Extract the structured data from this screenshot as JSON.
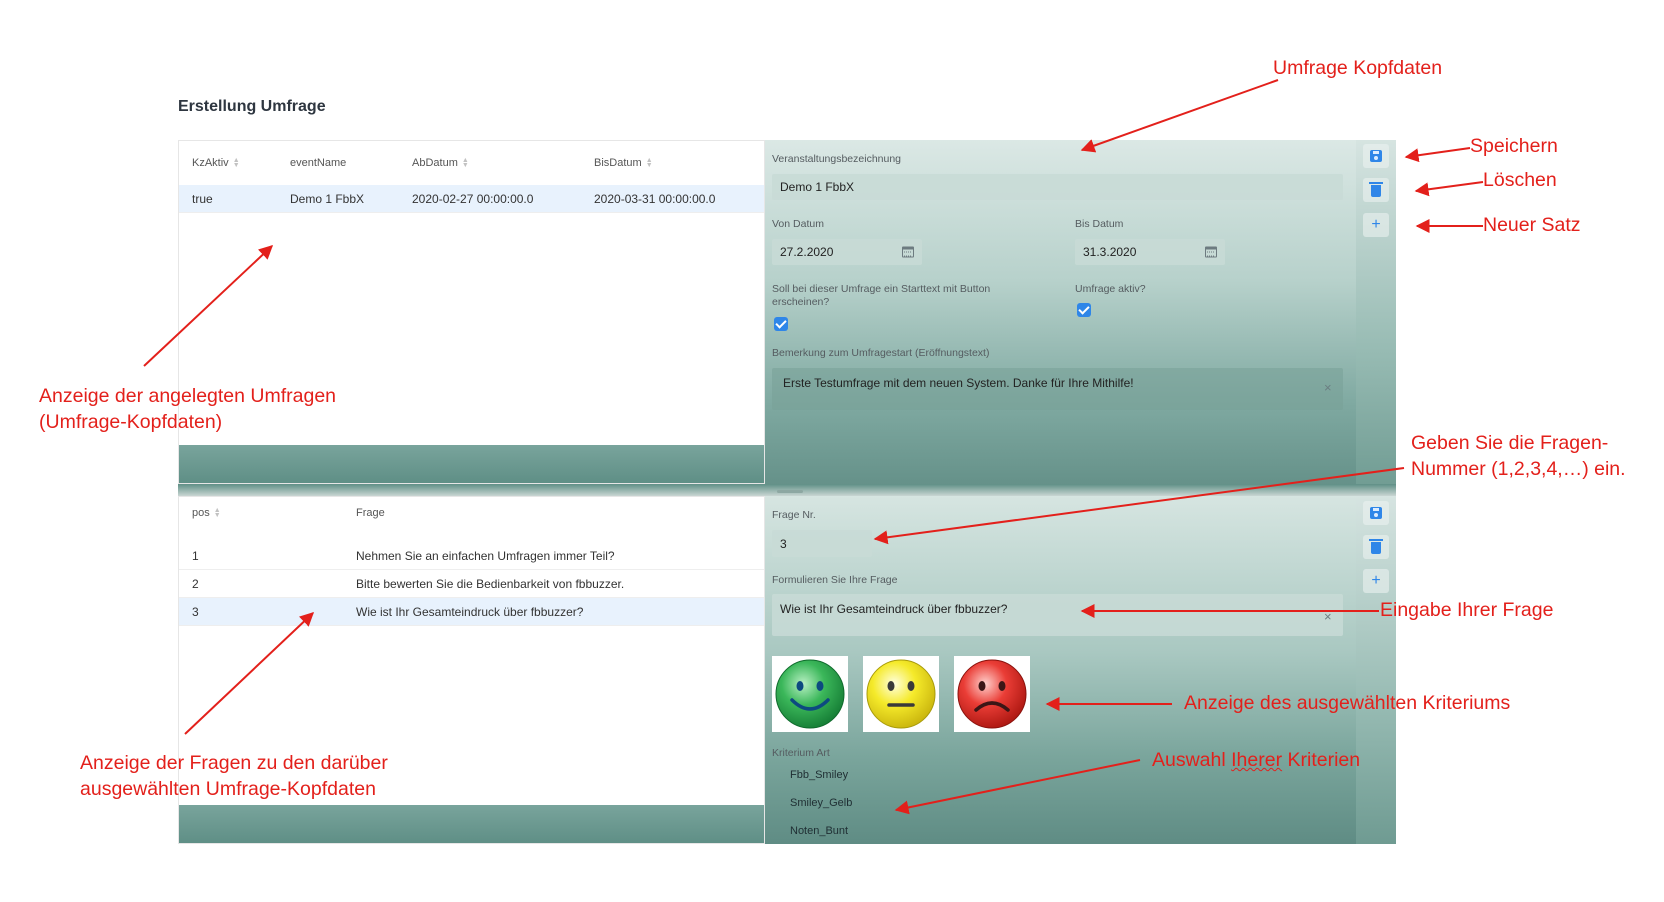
{
  "page": {
    "title": "Erstellung Umfrage"
  },
  "survey_table": {
    "columns": [
      "KzAktiv",
      "eventName",
      "AbDatum",
      "BisDatum"
    ],
    "rows": [
      [
        "true",
        "Demo 1 FbbX",
        "2020-02-27 00:00:00.0",
        "2020-03-31 00:00:00.0"
      ]
    ],
    "selected_row": 0
  },
  "survey_form": {
    "name_label": "Veranstaltungsbezeichnung",
    "name_value": "Demo 1 FbbX",
    "from_label": "Von Datum",
    "from_value": "27.2.2020",
    "to_label": "Bis Datum",
    "to_value": "31.3.2020",
    "starttext_label_1": "Soll bei dieser Umfrage ein Starttext mit Button",
    "starttext_label_2": "erscheinen?",
    "starttext_checked": true,
    "active_label": "Umfrage aktiv?",
    "active_checked": true,
    "remark_label": "Bemerkung zum Umfragestart (Eröffnungstext)",
    "remark_value": "Erste Testumfrage mit dem neuen System. Danke für Ihre Mithilfe!",
    "clear_glyph": "×"
  },
  "question_table": {
    "columns": [
      "pos",
      "Frage"
    ],
    "rows": [
      [
        "1",
        "Nehmen Sie an einfachen Umfragen immer Teil?"
      ],
      [
        "2",
        "Bitte bewerten Sie die Bedienbarkeit von fbbuzzer."
      ],
      [
        "3",
        "Wie ist Ihr Gesamteindruck über fbbuzzer?"
      ]
    ],
    "selected_row": 2
  },
  "question_form": {
    "nr_label": "Frage Nr.",
    "nr_value": "3",
    "question_label": "Formulieren Sie Ihre Frage",
    "question_value": "Wie ist Ihr Gesamteindruck über fbbuzzer?",
    "clear_glyph": "×",
    "criteria_label": "Kriterium Art",
    "criteria_options": [
      "Fbb_Smiley",
      "Smiley_Gelb",
      "Noten_Bunt"
    ],
    "smileys": [
      {
        "name": "happy-smiley-icon",
        "color": "#2fa84f"
      },
      {
        "name": "neutral-smiley-icon",
        "color": "#f2e21c"
      },
      {
        "name": "sad-smiley-icon",
        "color": "#e53a35"
      }
    ]
  },
  "toolbar": {
    "icons": [
      "save-icon",
      "trash-icon",
      "plus-icon"
    ],
    "plus_glyph": "+"
  },
  "annotations": {
    "kopfdaten": "Umfrage Kopfdaten",
    "speichern": "Speichern",
    "loeschen": "Löschen",
    "neuer_satz": "Neuer Satz",
    "anzeige_umfragen_1": "Anzeige der angelegten Umfragen",
    "anzeige_umfragen_2": "(Umfrage-Kopfdaten)",
    "fragen_nummer_1": "Geben Sie die Fragen-",
    "fragen_nummer_2": "Nummer (1,2,3,4,…) ein.",
    "eingabe_frage": "Eingabe Ihrer Frage",
    "anzeige_kriterium": "Anzeige des ausgewählten Kriteriums",
    "auswahl_1": "Auswahl ",
    "auswahl_2": "Iherer",
    "auswahl_3": " Kriterien",
    "anzeige_fragen_1": "Anzeige der Fragen zu den darüber",
    "anzeige_fragen_2": "ausgewählten Umfrage-Kopfdaten",
    "color": "#e3201b"
  },
  "colors": {
    "accent": "#2f86e8",
    "selected_row": "#e8f2fd",
    "annotation": "#e3201b"
  }
}
